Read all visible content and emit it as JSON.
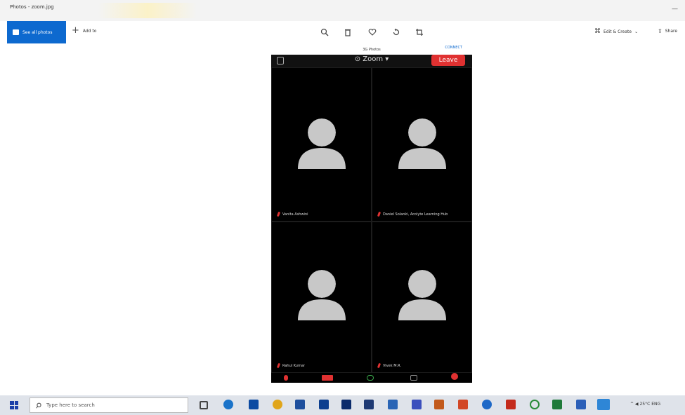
{
  "window": {
    "title": "Photos - zoom.jpg",
    "minimize": "—"
  },
  "toolbar": {
    "see_all_label": "See all photos",
    "add_to_label": "Add to",
    "tools": [
      "zoom-icon",
      "delete-icon",
      "heart-icon",
      "rotate-icon",
      "crop-icon"
    ],
    "edit_create_label": "Edit & Create",
    "share_label": "Share"
  },
  "phone": {
    "top_label": "3G Photos",
    "top_right": "CONNECT",
    "zoom_title": "⊙ Zoom ▾",
    "leave_label": "Leave",
    "participants": [
      {
        "name": "Vanita Ashwini"
      },
      {
        "name": "Daniel Solanki, Acolyte Learning Hub"
      },
      {
        "name": "Rahul Kumar"
      },
      {
        "name": "Vivek M.R."
      }
    ]
  },
  "taskbar": {
    "search_placeholder": "Type here to search",
    "tray_text": "^ ◀ 25°C ENG"
  },
  "colors": {
    "accent": "#0d69cf",
    "leave": "#e03131",
    "phone_bg": "#000000"
  }
}
